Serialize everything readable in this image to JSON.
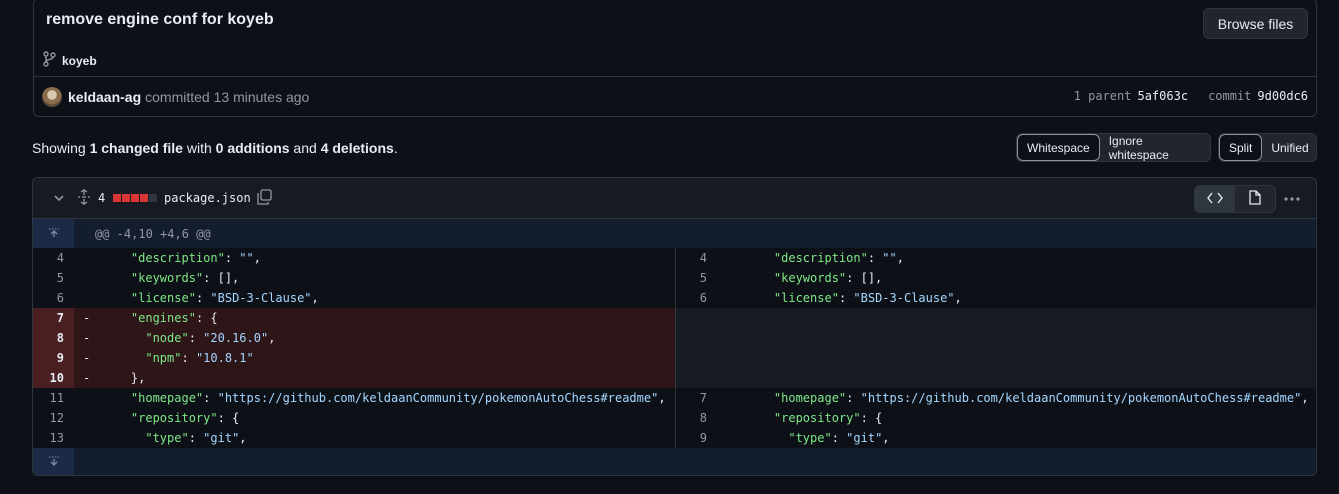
{
  "commit": {
    "title": "remove engine conf for koyeb",
    "browse_label": "Browse files",
    "branch": "koyeb",
    "author": "keldaan-ag",
    "action": "committed 13 minutes ago",
    "parent_label": "1 parent",
    "parent_hash": "5af063c",
    "commit_label": "commit",
    "commit_hash": "9d00dc6"
  },
  "summary": {
    "prefix": "Showing ",
    "changed": "1 changed file",
    "mid1": " with ",
    "additions": "0 additions",
    "mid2": " and ",
    "deletions": "4 deletions",
    "suffix": "."
  },
  "whitespace_options": [
    "Whitespace",
    "Ignore whitespace"
  ],
  "view_options": [
    "Split",
    "Unified"
  ],
  "file": {
    "deletions_count": "4",
    "name": "package.json",
    "hunk_header": "@@ -4,10 +4,6 @@",
    "left_lines": [
      {
        "n": "4",
        "m": "",
        "type": "ctx",
        "parts": [
          [
            "    ",
            ""
          ],
          [
            "\"description\"",
            "k"
          ],
          [
            ": ",
            ""
          ],
          [
            "\"\"",
            "s"
          ],
          [
            ",",
            ""
          ]
        ]
      },
      {
        "n": "5",
        "m": "",
        "type": "ctx",
        "parts": [
          [
            "    ",
            ""
          ],
          [
            "\"keywords\"",
            "k"
          ],
          [
            ": [],",
            ""
          ]
        ]
      },
      {
        "n": "6",
        "m": "",
        "type": "ctx",
        "parts": [
          [
            "    ",
            ""
          ],
          [
            "\"license\"",
            "k"
          ],
          [
            ": ",
            ""
          ],
          [
            "\"BSD-3-Clause\"",
            "s"
          ],
          [
            ",",
            ""
          ]
        ]
      },
      {
        "n": "7",
        "m": "-",
        "type": "del",
        "parts": [
          [
            "    ",
            ""
          ],
          [
            "\"engines\"",
            "k"
          ],
          [
            ": {",
            ""
          ]
        ]
      },
      {
        "n": "8",
        "m": "-",
        "type": "del",
        "parts": [
          [
            "      ",
            ""
          ],
          [
            "\"node\"",
            "k"
          ],
          [
            ": ",
            ""
          ],
          [
            "\"20.16.0\"",
            "s"
          ],
          [
            ",",
            ""
          ]
        ]
      },
      {
        "n": "9",
        "m": "-",
        "type": "del",
        "parts": [
          [
            "      ",
            ""
          ],
          [
            "\"npm\"",
            "k"
          ],
          [
            ": ",
            ""
          ],
          [
            "\"10.8.1\"",
            "s"
          ]
        ]
      },
      {
        "n": "10",
        "m": "-",
        "type": "del",
        "parts": [
          [
            "    },",
            ""
          ]
        ]
      },
      {
        "n": "11",
        "m": "",
        "type": "ctx",
        "parts": [
          [
            "    ",
            ""
          ],
          [
            "\"homepage\"",
            "k"
          ],
          [
            ": ",
            ""
          ],
          [
            "\"https://github.com/keldaanCommunity/pokemonAutoChess#readme\"",
            "s"
          ],
          [
            ",",
            ""
          ]
        ]
      },
      {
        "n": "12",
        "m": "",
        "type": "ctx",
        "parts": [
          [
            "    ",
            ""
          ],
          [
            "\"repository\"",
            "k"
          ],
          [
            ": {",
            ""
          ]
        ]
      },
      {
        "n": "13",
        "m": "",
        "type": "ctx",
        "parts": [
          [
            "      ",
            ""
          ],
          [
            "\"type\"",
            "k"
          ],
          [
            ": ",
            ""
          ],
          [
            "\"git\"",
            "s"
          ],
          [
            ",",
            ""
          ]
        ]
      }
    ],
    "right_lines": [
      {
        "n": "4",
        "m": "",
        "type": "ctx",
        "parts": [
          [
            "    ",
            ""
          ],
          [
            "\"description\"",
            "k"
          ],
          [
            ": ",
            ""
          ],
          [
            "\"\"",
            "s"
          ],
          [
            ",",
            ""
          ]
        ]
      },
      {
        "n": "5",
        "m": "",
        "type": "ctx",
        "parts": [
          [
            "    ",
            ""
          ],
          [
            "\"keywords\"",
            "k"
          ],
          [
            ": [],",
            ""
          ]
        ]
      },
      {
        "n": "6",
        "m": "",
        "type": "ctx",
        "parts": [
          [
            "    ",
            ""
          ],
          [
            "\"license\"",
            "k"
          ],
          [
            ": ",
            ""
          ],
          [
            "\"BSD-3-Clause\"",
            "s"
          ],
          [
            ",",
            ""
          ]
        ]
      },
      {
        "n": "",
        "m": "",
        "type": "empty",
        "parts": []
      },
      {
        "n": "",
        "m": "",
        "type": "empty",
        "parts": []
      },
      {
        "n": "",
        "m": "",
        "type": "empty",
        "parts": []
      },
      {
        "n": "",
        "m": "",
        "type": "empty",
        "parts": []
      },
      {
        "n": "7",
        "m": "",
        "type": "ctx",
        "parts": [
          [
            "    ",
            ""
          ],
          [
            "\"homepage\"",
            "k"
          ],
          [
            ": ",
            ""
          ],
          [
            "\"https://github.com/keldaanCommunity/pokemonAutoChess#readme\"",
            "s"
          ],
          [
            ",",
            ""
          ]
        ]
      },
      {
        "n": "8",
        "m": "",
        "type": "ctx",
        "parts": [
          [
            "    ",
            ""
          ],
          [
            "\"repository\"",
            "k"
          ],
          [
            ": {",
            ""
          ]
        ]
      },
      {
        "n": "9",
        "m": "",
        "type": "ctx",
        "parts": [
          [
            "      ",
            ""
          ],
          [
            "\"type\"",
            "k"
          ],
          [
            ": ",
            ""
          ],
          [
            "\"git\"",
            "s"
          ],
          [
            ",",
            ""
          ]
        ]
      }
    ]
  },
  "colors": {
    "deleted_line_bg": "#2d1518",
    "deleted_gutter_bg": "#4a1f22",
    "hunk_bg": "#131d2e",
    "json_key": "#7ee787",
    "json_string": "#a5d6ff"
  }
}
